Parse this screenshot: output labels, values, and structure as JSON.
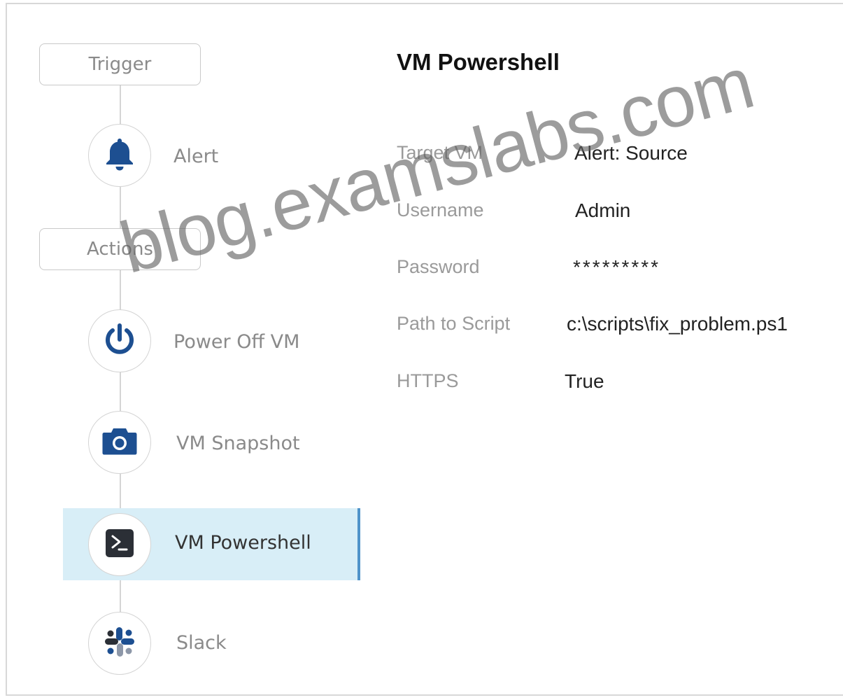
{
  "workflow": {
    "sections": {
      "trigger_label": "Trigger",
      "actions_label": "Actions"
    },
    "steps": [
      {
        "label": "Alert",
        "icon": "bell-icon"
      },
      {
        "label": "Power Off VM",
        "icon": "power-icon"
      },
      {
        "label": "VM Snapshot",
        "icon": "camera-icon"
      },
      {
        "label": "VM Powershell",
        "icon": "powershell-icon",
        "selected": true
      },
      {
        "label": "Slack",
        "icon": "slack-icon"
      }
    ]
  },
  "detail": {
    "title": "VM Powershell",
    "fields": [
      {
        "label": "Target VM",
        "value": "Alert: Source"
      },
      {
        "label": "Username",
        "value": "Admin"
      },
      {
        "label": "Password",
        "value": "*********"
      },
      {
        "label": "Path to Script",
        "value": "c:\\scripts\\fix_problem.ps1"
      },
      {
        "label": "HTTPS",
        "value": "True"
      }
    ]
  },
  "watermark": "blog.examslabs.com",
  "colors": {
    "icon_blue": "#1d4f91",
    "selected_bg": "#d8eef7",
    "selected_border": "#4f93c9"
  }
}
